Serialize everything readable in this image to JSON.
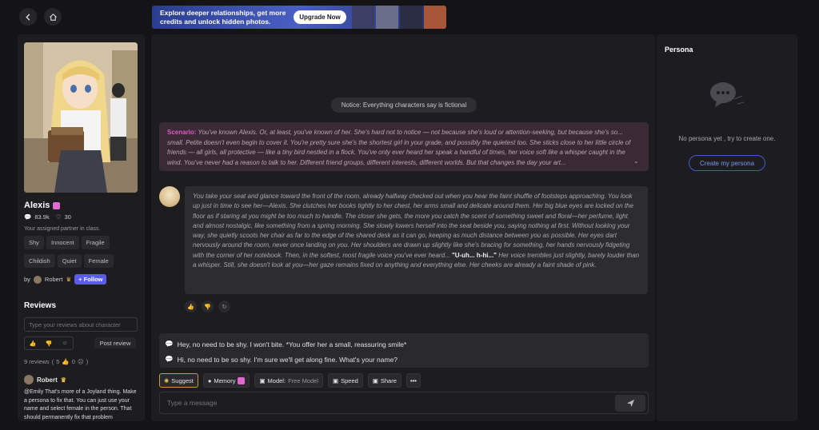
{
  "banner": {
    "text": "Explore deeper relationships, get more credits and unlock hidden photos.",
    "button": "Upgrade Now"
  },
  "character": {
    "name": "Alexis",
    "chats": "83.9k",
    "likes": "30",
    "description": "Your assigned partner in class.",
    "tags": [
      "Shy",
      "Innocent",
      "Fragile",
      "Childish",
      "Quiet",
      "Female"
    ],
    "by_prefix": "by",
    "creator": "Robert",
    "follow_label": "Follow"
  },
  "reviews": {
    "heading": "Reviews",
    "placeholder": "Type your reviews about character",
    "post_label": "Post review",
    "count_text": "9 reviews",
    "up_count": "5",
    "down_count": "0",
    "first_reviewer": "Robert",
    "first_review": "@Emily That's more of a Joyland thing. Make a persona to fix that. You can just use your name and select female in the person. That should permanently fix that problem"
  },
  "chat": {
    "notice": "Notice: Everything characters say is fictional",
    "scenario_label": "Scenario:",
    "scenario_text": "You've known Alexis. Or, at least, you've known of her. She's hard not to notice — not because she's loud or attention-seeking, but because she's so... small. Petite doesn't even begin to cover it. You're pretty sure she's the shortest girl in your grade, and possibly the quietest too. She sticks close to her little circle of friends — all girls, all protective — like a tiny bird nestled in a flock. You've only ever heard her speak a handful of times, her voice soft like a whisper caught in the wind. You've never had a reason to talk to her. Different friend groups, different interests, different worlds. But that changes the day your art...",
    "message_part1": "You take your seat and glance toward the front of the room, already halfway checked out when you hear the faint shuffle of footsteps approaching. You look up just in time to see her—Alexis. She clutches her books tightly to her chest, her arms small and delicate around them. Her big blue eyes are locked on the floor as if staring at you might be too much to handle. The closer she gets, the more you catch the scent of something sweet and floral—her perfume, light and almost nostalgic, like something from a spring morning. She slowly lowers herself into the seat beside you, saying nothing at first. Without looking your way, she quietly scoots her chair as far to the edge of the shared desk as it can go, keeping as much distance between you as possible. Her eyes dart nervously around the room, never once landing on you. Her shoulders are drawn up slightly like she's bracing for something, her hands nervously fidgeting with the corner of her notebook. Then, in the softest, most fragile voice you've ever heard...",
    "message_quote": "\"U-uh... h-hi...\"",
    "message_part2": "Her voice trembles just slightly, barely louder than a whisper. Still, she doesn't look at you—her gaze remains fixed on anything and everything else. Her cheeks are already a faint shade of pink.",
    "suggestions": [
      "Hey, no need to be shy. I won't bite. *You offer her a small, reassuring smile*",
      "Hi, no need to be so shy. I'm sure we'll get along fine. What's your name?"
    ],
    "toolbar": {
      "suggest": "Suggest",
      "memory": "Memory",
      "model_label": "Model:",
      "model_value": "Free Model",
      "speed": "Speed",
      "share": "Share"
    },
    "input_placeholder": "Type a message"
  },
  "persona": {
    "title": "Persona",
    "empty_text": "No persona yet , try to create one.",
    "create_label": "Create my persona"
  }
}
